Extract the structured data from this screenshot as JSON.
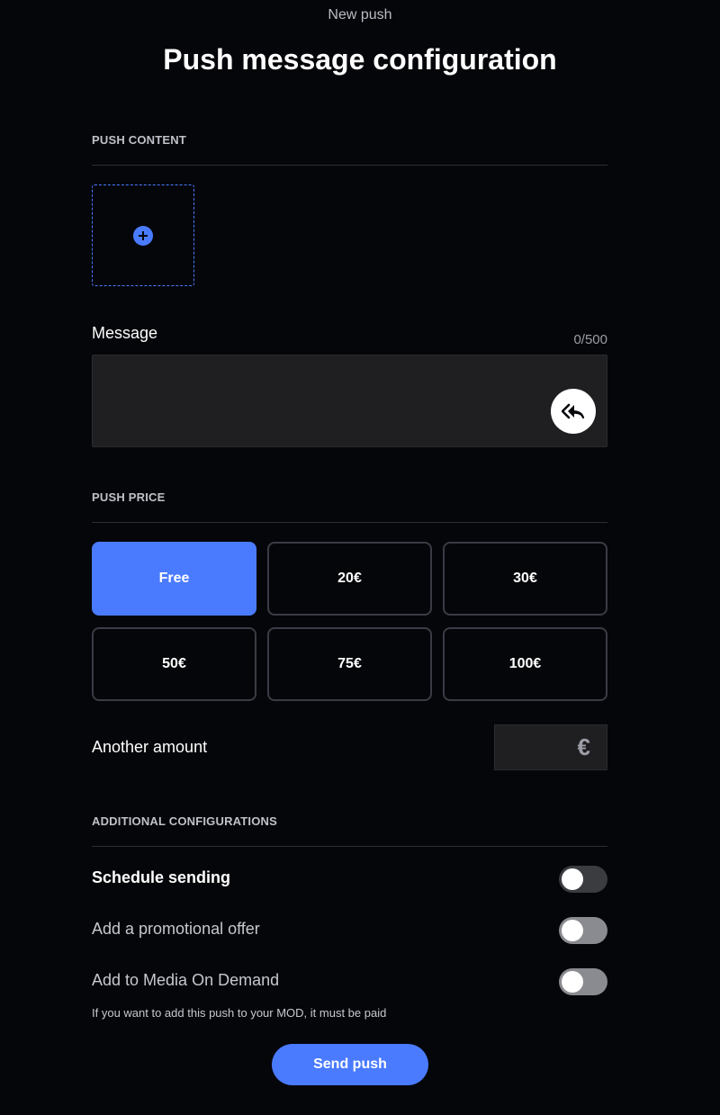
{
  "header": {
    "top_label": "New push",
    "title": "Push message configuration"
  },
  "content": {
    "section_title": "PUSH CONTENT",
    "upload_icon": "plus-circle-icon",
    "message_label": "Message",
    "char_count": "0/500",
    "message_value": "",
    "reply_icon": "reply-all-icon"
  },
  "price": {
    "section_title": "PUSH PRICE",
    "options": [
      {
        "label": "Free",
        "selected": true
      },
      {
        "label": "20€",
        "selected": false
      },
      {
        "label": "30€",
        "selected": false
      },
      {
        "label": "50€",
        "selected": false
      },
      {
        "label": "75€",
        "selected": false
      },
      {
        "label": "100€",
        "selected": false
      }
    ],
    "another_amount_label": "Another amount",
    "another_amount_value": "",
    "currency_symbol": "€"
  },
  "additional": {
    "section_title": "ADDITIONAL CONFIGURATIONS",
    "schedule_label": "Schedule sending",
    "schedule_on": false,
    "promo_label": "Add a promotional offer",
    "promo_on": false,
    "mod_label": "Add to Media On Demand",
    "mod_on": false,
    "mod_helper": "If you want to add this push to your MOD, it must be paid"
  },
  "actions": {
    "send_label": "Send push"
  },
  "colors": {
    "accent": "#4a7bff",
    "background": "#05060a",
    "field_bg": "#1f1f21"
  }
}
